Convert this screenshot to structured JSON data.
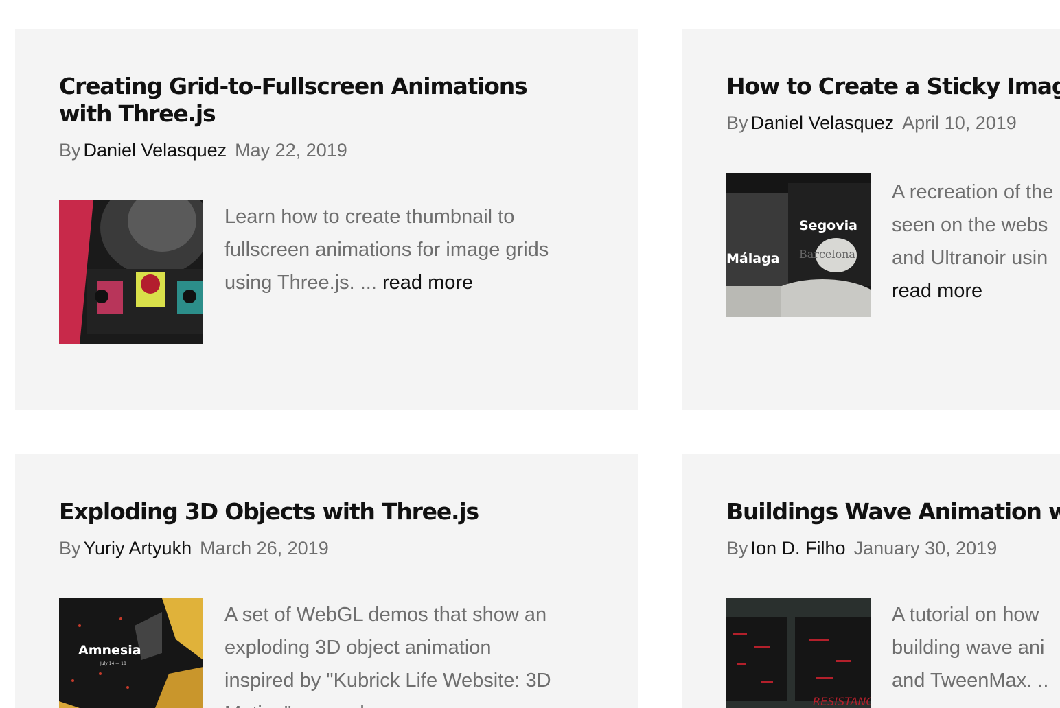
{
  "cards": [
    {
      "title": "Creating Grid-to-Fullscreen Animations with Three.js",
      "by": "By",
      "author": "Daniel Velasquez",
      "date": "May 22, 2019",
      "excerpt": "Learn how to create thumbnail to fullscreen animations for image grids using Three.js. ...",
      "read_more": "read more",
      "thumb_alt": "portrait grid thumbnail"
    },
    {
      "title": "How to Create a Sticky Image Eff",
      "by": "By",
      "author": "Daniel Velasquez",
      "date": "April 10, 2019",
      "excerpt_lines": [
        "A recreation of the",
        "seen on the webs",
        "and Ultranoir usin"
      ],
      "read_more": "read more",
      "thumb_words": [
        "Segovia",
        "Málaga",
        "Barcelona"
      ]
    },
    {
      "title": "Exploding 3D Objects with Three.js",
      "by": "By",
      "author": "Yuriy Artyukh",
      "date": "March 26, 2019",
      "excerpt_lines": [
        "A set of WebGL demos that show an",
        "exploding 3D object animation",
        "inspired by \"Kubrick Life Website: 3D",
        "Motion\". ... read"
      ],
      "thumb_words": [
        "Amnesia",
        "July 14 — 18"
      ]
    },
    {
      "title": "Buildings Wave Animation with T",
      "by": "By",
      "author": "Ion D. Filho",
      "date": "January 30, 2019",
      "excerpt_lines": [
        "A tutorial on how",
        "building wave ani",
        "and TweenMax. .."
      ],
      "thumb_words": [
        "RESISTANC"
      ]
    }
  ],
  "colors": {
    "card_bg": "#f4f4f4",
    "title": "#111111",
    "muted": "#6e6e6e"
  }
}
